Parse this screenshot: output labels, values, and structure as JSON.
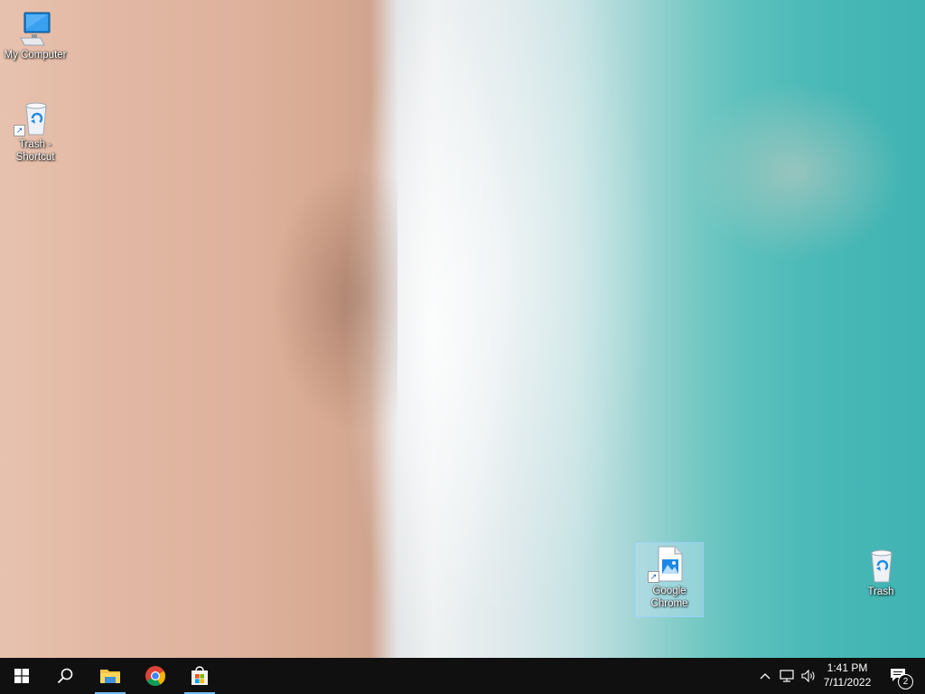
{
  "desktop": {
    "wallpaper": "aerial beach with sand, surf and turquoise sea",
    "icons": [
      {
        "name": "my-computer",
        "label": "My Computer",
        "icon": "monitor-icon"
      },
      {
        "name": "trash-shortcut",
        "label": "Trash - Shortcut",
        "icon": "recycle-bin-icon",
        "shortcut": true
      },
      {
        "name": "google-chrome",
        "label": "Google Chrome",
        "icon": "image-file-icon",
        "shortcut": true,
        "selected": true
      },
      {
        "name": "trash",
        "label": "Trash",
        "icon": "recycle-bin-icon"
      }
    ]
  },
  "taskbar": {
    "start": {
      "icon": "windows-logo-icon"
    },
    "search": {
      "icon": "search-icon"
    },
    "pinned": [
      {
        "name": "file-explorer",
        "icon": "folder-icon",
        "active": true
      },
      {
        "name": "chrome",
        "icon": "chrome-icon",
        "active": false
      },
      {
        "name": "microsoft-store",
        "icon": "store-icon",
        "active": true
      }
    ],
    "tray": {
      "chevron_icon": "chevron-up-icon",
      "network_icon": "network-icon",
      "volume_icon": "volume-icon",
      "time": "1:41 PM",
      "date": "7/11/2022",
      "notifications_count": "2"
    }
  },
  "colors": {
    "taskbar_bg": "#101010",
    "active_indicator": "#76b9ed",
    "selection_border": "#99d1ff"
  }
}
